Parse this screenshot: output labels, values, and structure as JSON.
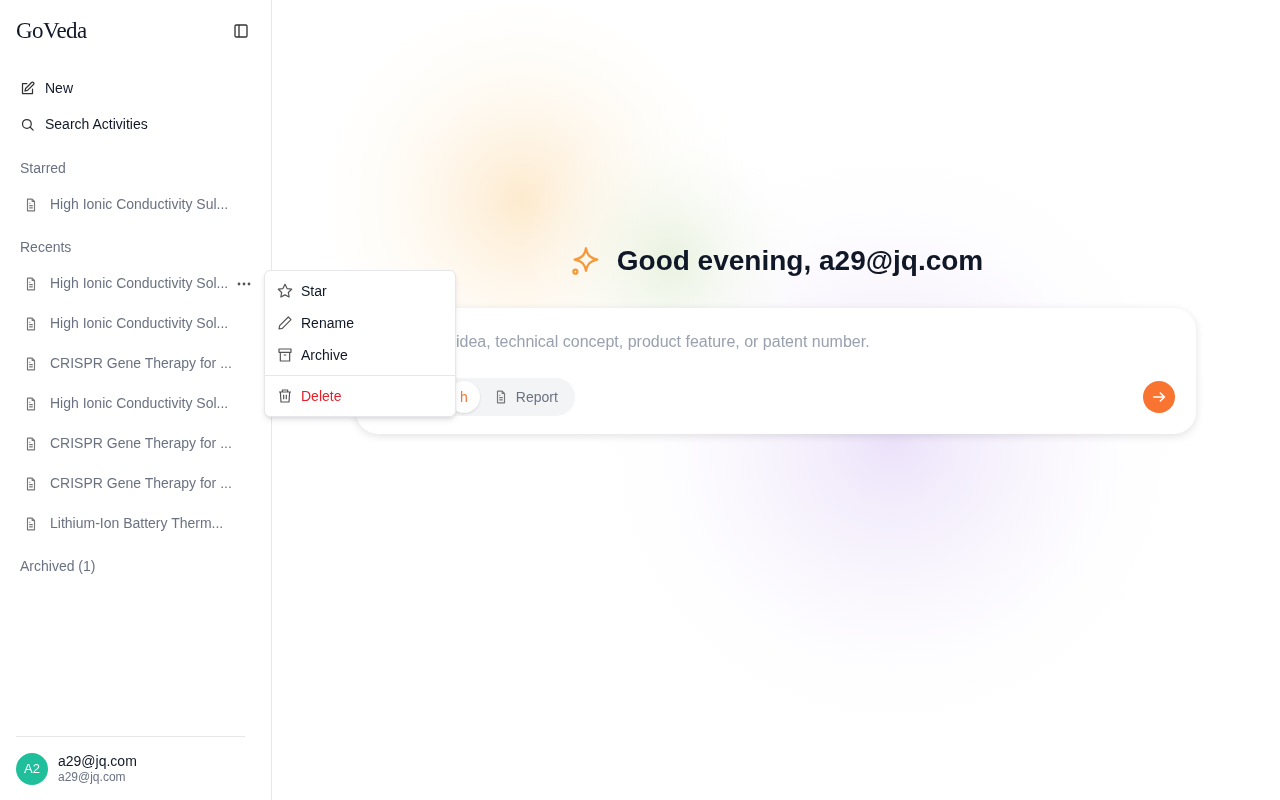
{
  "sidebar": {
    "logo": "GoVeda",
    "actions": [
      {
        "kind": "new",
        "label": "New"
      },
      {
        "kind": "search",
        "label": "Search Activities"
      }
    ],
    "sections": [
      {
        "title": "Starred",
        "items": [
          {
            "label": "High Ionic Conductivity Sul...",
            "menu_open": false
          }
        ]
      },
      {
        "title": "Recents",
        "items": [
          {
            "label": "High Ionic Conductivity Sol...",
            "menu_open": true
          },
          {
            "label": "High Ionic Conductivity Sol...",
            "menu_open": false
          },
          {
            "label": "CRISPR Gene Therapy for ...",
            "menu_open": false
          },
          {
            "label": "High Ionic Conductivity Sol...",
            "menu_open": false
          },
          {
            "label": "CRISPR Gene Therapy for ...",
            "menu_open": false
          },
          {
            "label": "CRISPR Gene Therapy for ...",
            "menu_open": false
          },
          {
            "label": "Lithium-Ion Battery Therm...",
            "menu_open": false
          }
        ]
      },
      {
        "title": "Archived (1)"
      }
    ],
    "user": {
      "avatar": "A2",
      "name": "a29@jq.com",
      "email": "a29@jq.com"
    }
  },
  "context_menu": {
    "items": [
      {
        "kind": "star",
        "label": "Star",
        "danger": false
      },
      {
        "kind": "rename",
        "label": "Rename",
        "danger": false
      },
      {
        "kind": "archive",
        "label": "Archive",
        "danger": false
      },
      {
        "kind": "delete",
        "label": "Delete",
        "danger": true
      }
    ]
  },
  "main": {
    "greeting": "Good evening, a29@jq.com",
    "input": {
      "placeholder": "idea, technical concept, product feature, or patent number."
    },
    "modes": [
      {
        "label": "h",
        "selected": true
      },
      {
        "label": "Report",
        "selected": false
      }
    ]
  }
}
